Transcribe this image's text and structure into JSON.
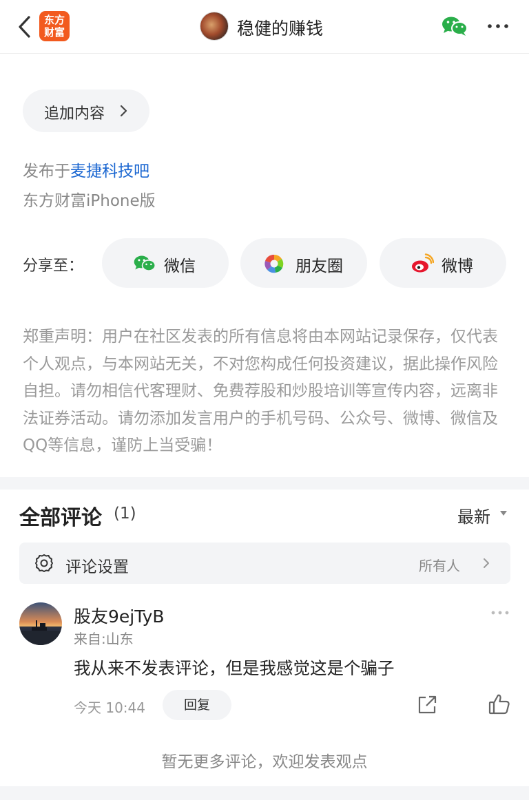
{
  "header": {
    "logo_text_line1": "东方",
    "logo_text_line2": "财富",
    "title": "稳健的赚钱"
  },
  "add_content": {
    "label": "追加内容"
  },
  "meta": {
    "published_prefix": "发布于",
    "forum": "麦捷科技吧",
    "client": "东方财富iPhone版"
  },
  "share": {
    "label": "分享至：",
    "buttons": [
      {
        "label": "微信",
        "icon": "wechat-icon"
      },
      {
        "label": "朋友圈",
        "icon": "moments-icon"
      },
      {
        "label": "微博",
        "icon": "weibo-icon"
      }
    ]
  },
  "disclaimer": "郑重声明：用户在社区发表的所有信息将由本网站记录保存，仅代表个人观点，与本网站无关，不对您构成任何投资建议，据此操作风险自担。请勿相信代客理财、免费荐股和炒股培训等宣传内容，远离非法证券活动。请勿添加发言用户的手机号码、公众号、微博、微信及QQ等信息，谨防上当受骗！",
  "comments": {
    "title": "全部评论",
    "count": "(1)",
    "sort": "最新",
    "settings_label": "评论设置",
    "settings_value": "所有人",
    "items": [
      {
        "user": "股友9ejTyB",
        "from": "来自:山东",
        "text": "我从来不发表评论，但是我感觉这是个骗子",
        "time": "今天 10:44",
        "reply_label": "回复"
      }
    ],
    "no_more": "暂无更多评论，欢迎发表观点"
  },
  "colors": {
    "brand": "#f25a1e",
    "link": "#1a66d1",
    "wechat_green": "#2aae4a",
    "weibo_red": "#e6162d"
  }
}
